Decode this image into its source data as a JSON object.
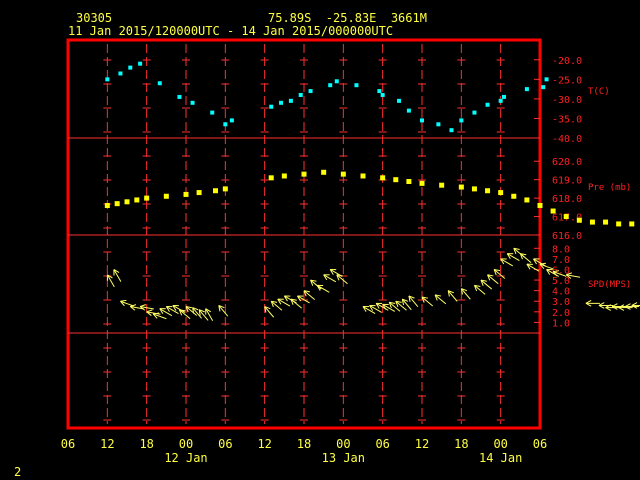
{
  "header": {
    "station_id": "30305",
    "location": "75.89S  -25.83E  3661M",
    "time_range": "11 Jan 2015/120000UTC - 14 Jan 2015/000000UTC"
  },
  "page_number": "2",
  "colors": {
    "background": "#000000",
    "frame": "#ff0000",
    "grid": "#ff3030",
    "axis_text": "#ff2020",
    "header_text": "#ffff44",
    "temperature": "#00ffff",
    "pressure": "#ffff00",
    "wind": "#ffff66"
  },
  "chart_data": [
    {
      "type": "scatter",
      "ylabel": "T(C)",
      "ylim": [
        -40,
        -17.5
      ],
      "yticks": [
        -20.0,
        -25.0,
        -30.0,
        -35.0,
        -40.0
      ],
      "ytick_labels": [
        "-20.0",
        "-25.0",
        "-30.0",
        "-35.0",
        "-40.0"
      ],
      "x_hours_since_11jan_06utc": [
        6,
        8,
        9.5,
        11,
        14,
        17,
        19,
        22,
        24,
        25,
        31,
        32.5,
        34,
        35.5,
        37,
        40,
        41,
        44,
        47.5,
        48,
        50.5,
        52,
        54,
        56.5,
        58.5,
        60,
        62,
        64,
        66,
        66.5,
        70,
        72.5,
        73
      ],
      "values": [
        -25,
        -23.5,
        -22,
        -21,
        -26,
        -29.5,
        -31,
        -33.5,
        -36.5,
        -35.5,
        -32,
        -31,
        -30.5,
        -29,
        -28,
        -26.5,
        -25.5,
        -26.5,
        -28,
        -29,
        -30.5,
        -33,
        -35.5,
        -36.5,
        -38,
        -35.5,
        -33.5,
        -31.5,
        -30.5,
        -29.5,
        -27.5,
        -27,
        -25
      ]
    },
    {
      "type": "scatter",
      "ylabel": "Pre (mb)",
      "ylim": [
        616,
        620.5
      ],
      "yticks": [
        616.0,
        617.0,
        618.0,
        619.0,
        620.0
      ],
      "ytick_labels": [
        "616.0",
        "617.0",
        "618.0",
        "619.0",
        "620.0"
      ],
      "x_hours_since_11jan_06utc": [
        6,
        7.5,
        9,
        10.5,
        12,
        15,
        18,
        20,
        22.5,
        24,
        31,
        33,
        36,
        39,
        42,
        45,
        48,
        50,
        52,
        54,
        57,
        60,
        62,
        64,
        66,
        68,
        70,
        72,
        74,
        76,
        78,
        80,
        82,
        84,
        86,
        88
      ],
      "values": [
        617.6,
        617.7,
        617.8,
        617.9,
        618.0,
        618.1,
        618.2,
        618.3,
        618.4,
        618.5,
        619.1,
        619.2,
        619.3,
        619.4,
        619.3,
        619.2,
        619.1,
        619.0,
        618.9,
        618.8,
        618.7,
        618.6,
        618.5,
        618.4,
        618.3,
        618.1,
        617.9,
        617.6,
        617.3,
        617.0,
        616.8,
        616.7,
        616.7,
        616.6,
        616.6,
        616.9
      ]
    },
    {
      "type": "scatter",
      "ylabel": "SPD(MPS)",
      "ylim": [
        0,
        8.5
      ],
      "yticks": [
        1.0,
        2.0,
        3.0,
        4.0,
        5.0,
        6.0,
        7.0,
        8.0
      ],
      "ytick_labels": [
        "1.0",
        "2.0",
        "3.0",
        "4.0",
        "5.0",
        "6.0",
        "7.0",
        "8.0"
      ],
      "x_hours_since_11jan_06utc": [
        6,
        7,
        8,
        9.5,
        11,
        12,
        13,
        14,
        15,
        16,
        17,
        18,
        19,
        20,
        21,
        23,
        30,
        31,
        32,
        33,
        34,
        35,
        36,
        37,
        38,
        39,
        40,
        41,
        45,
        46,
        47,
        48,
        49,
        50,
        51,
        52,
        54,
        56,
        58,
        60,
        62,
        63,
        64,
        65,
        66,
        67,
        68,
        69,
        70,
        71,
        72,
        73,
        74,
        76,
        79,
        81,
        82,
        83,
        84,
        85,
        86
      ],
      "values": [
        5.5,
        6.0,
        3.0,
        2.5,
        2.5,
        2.0,
        1.8,
        2.3,
        2.5,
        2.6,
        2.2,
        2.5,
        2.4,
        2.2,
        2.3,
        2.6,
        2.5,
        3.0,
        3.2,
        3.5,
        3.2,
        3.5,
        4.0,
        5.0,
        4.5,
        5.5,
        6.0,
        5.5,
        2.5,
        2.6,
        2.8,
        2.7,
        2.9,
        3.0,
        3.2,
        3.5,
        3.4,
        3.6,
        4.0,
        4.2,
        4.5,
        5.0,
        5.5,
        6.0,
        7.0,
        7.5,
        8.0,
        7.5,
        6.5,
        7.0,
        6.5,
        6.0,
        5.8,
        5.5,
        2.8,
        2.6,
        2.4,
        2.5,
        2.4,
        2.5,
        2.6
      ],
      "dir_deg": [
        60,
        60,
        20,
        10,
        10,
        10,
        20,
        30,
        30,
        30,
        40,
        40,
        50,
        50,
        60,
        50,
        50,
        40,
        30,
        30,
        40,
        30,
        40,
        40,
        30,
        30,
        30,
        40,
        30,
        30,
        30,
        30,
        40,
        40,
        50,
        50,
        40,
        40,
        50,
        50,
        40,
        40,
        40,
        40,
        30,
        30,
        40,
        40,
        30,
        30,
        20,
        30,
        20,
        10,
        0,
        0,
        0,
        0,
        0,
        0,
        0
      ]
    }
  ],
  "x_axis": {
    "hour_ticks": [
      "06",
      "12",
      "18",
      "00",
      "06",
      "12",
      "18",
      "00",
      "06",
      "12",
      "18",
      "00",
      "06"
    ],
    "date_labels": [
      {
        "text": "12 Jan",
        "under_tick": 3
      },
      {
        "text": "13 Jan",
        "under_tick": 7
      },
      {
        "text": "14 Jan",
        "under_tick": 11
      }
    ]
  }
}
